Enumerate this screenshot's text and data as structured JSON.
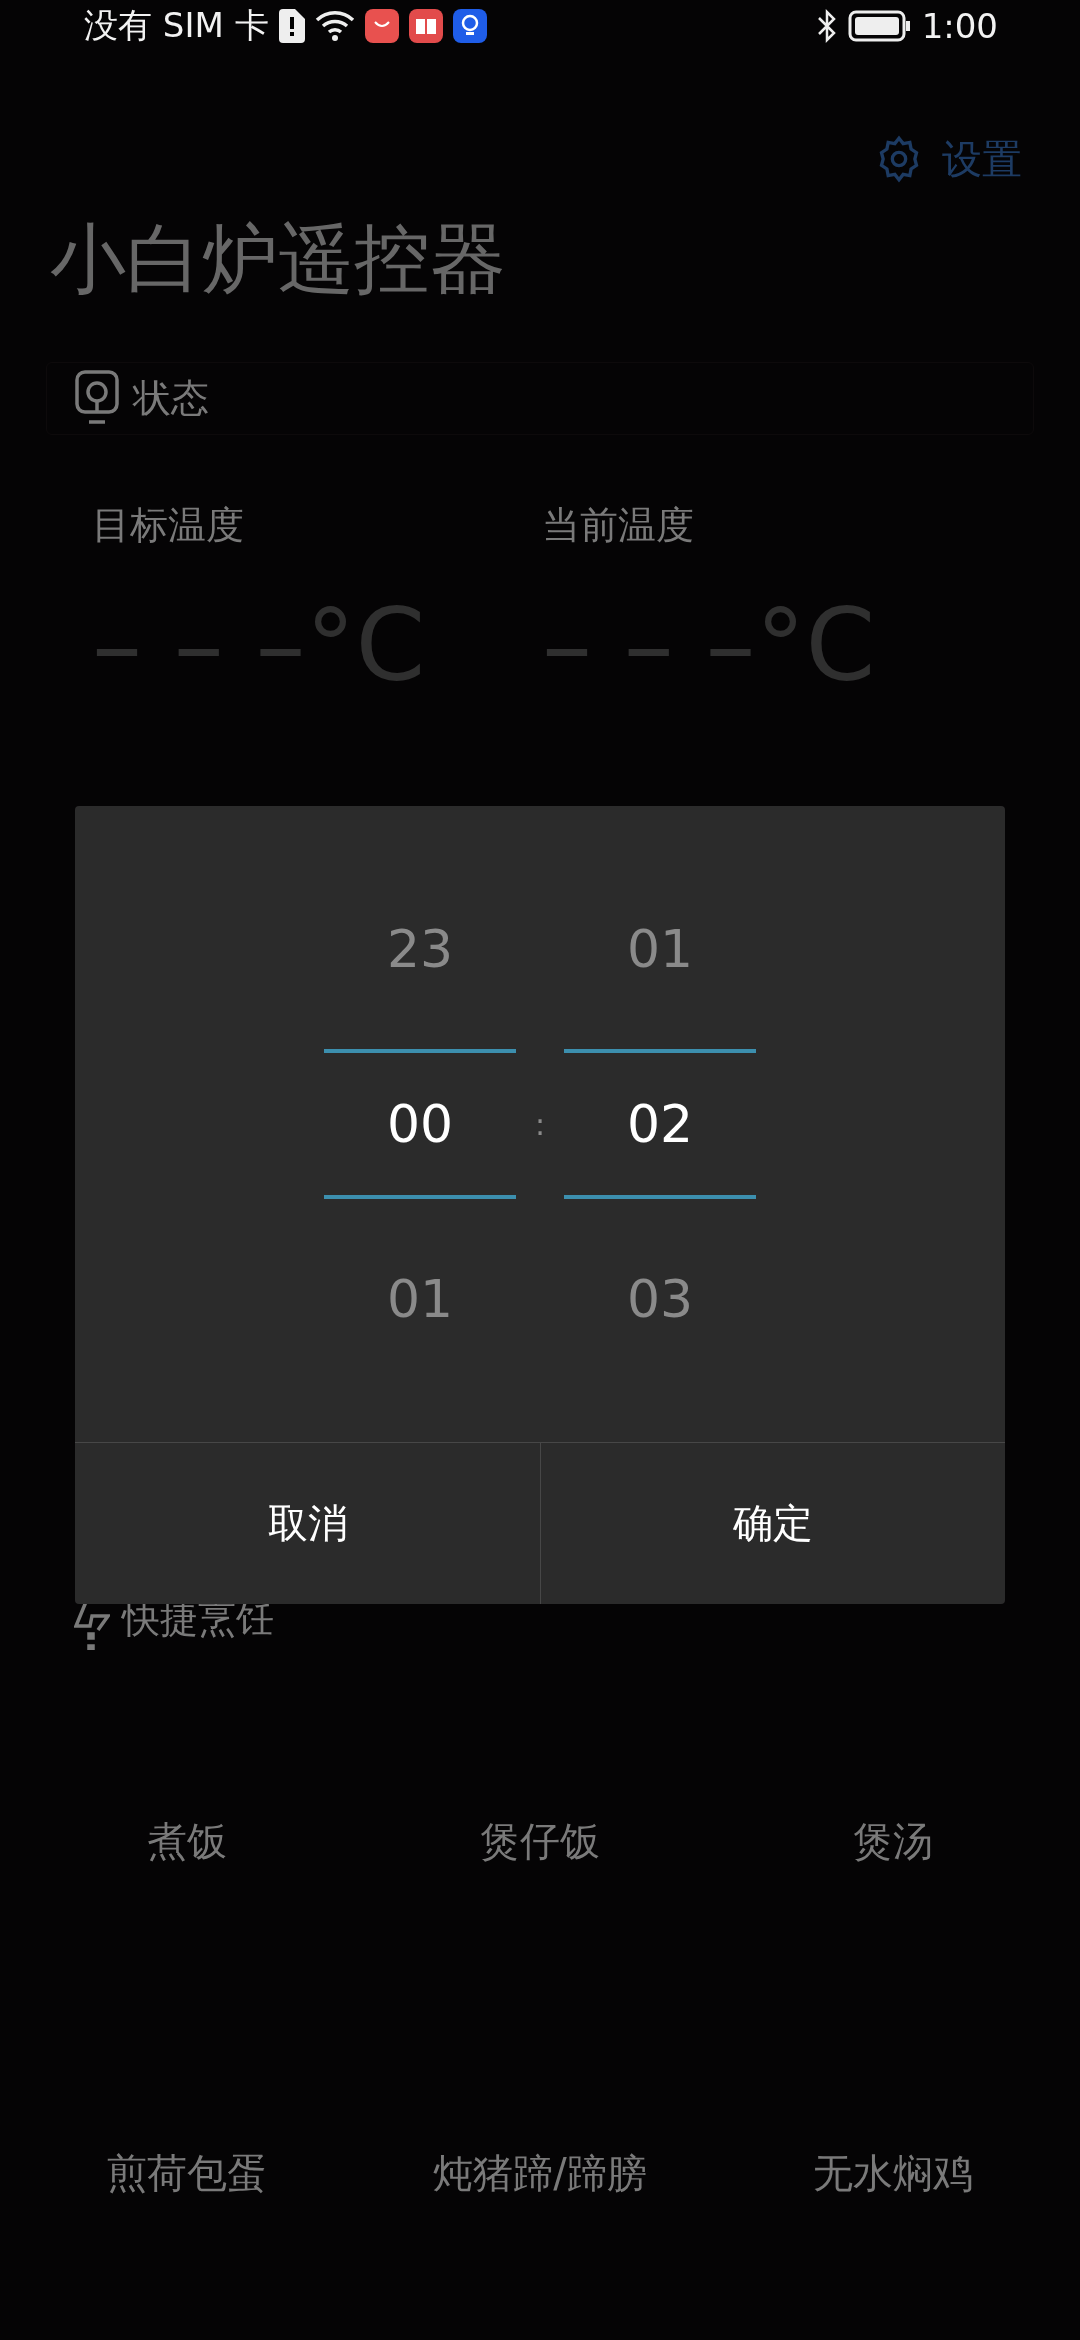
{
  "status_bar": {
    "carrier": "没有 SIM 卡",
    "time": "1:00"
  },
  "settings": {
    "label": "设置"
  },
  "title": "小白炉遥控器",
  "status_card": {
    "title": "状态"
  },
  "temperatures": [
    {
      "label": "目标温度",
      "value": "– – –",
      "unit": "°C"
    },
    {
      "label": "当前温度",
      "value": "– – –",
      "unit": "°C"
    }
  ],
  "time_picker": {
    "columns": [
      {
        "items": [
          {
            "value": "23",
            "selected": false
          },
          {
            "value": "00",
            "selected": true
          },
          {
            "value": "01",
            "selected": false
          }
        ]
      },
      {
        "items": [
          {
            "value": "01",
            "selected": false
          },
          {
            "value": "02",
            "selected": true
          },
          {
            "value": "03",
            "selected": false
          }
        ]
      }
    ],
    "separator": ":",
    "buttons": [
      "取消",
      "确定"
    ]
  },
  "quick_cooking": {
    "title": "快捷烹饪",
    "items": [
      "煮饭",
      "煲仔饭",
      "煲汤",
      "煎荷包蛋",
      "炖猪蹄/蹄膀",
      "无水焖鸡"
    ]
  }
}
